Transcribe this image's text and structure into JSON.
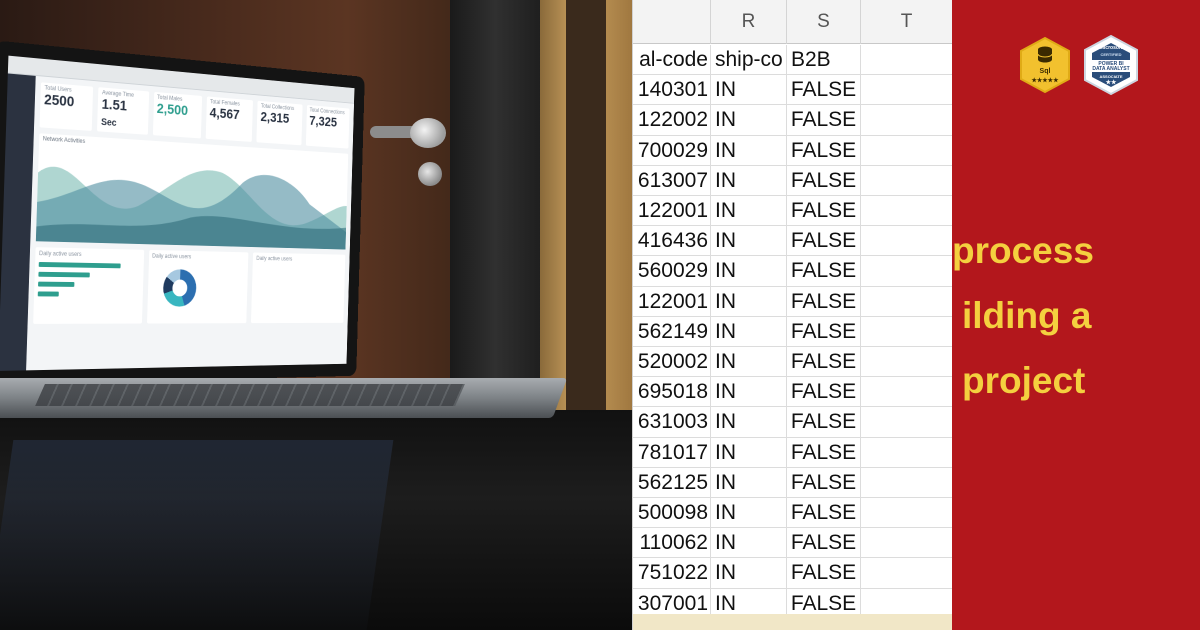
{
  "spreadsheet": {
    "column_headers": [
      "R",
      "S",
      "T"
    ],
    "field_headers": {
      "postal_code": "al-code",
      "ship_country": "ship-co",
      "b2b": "B2B"
    },
    "rows": [
      {
        "postal": "140301",
        "country": "IN",
        "b2b": "FALSE"
      },
      {
        "postal": "122002",
        "country": "IN",
        "b2b": "FALSE"
      },
      {
        "postal": "700029",
        "country": "IN",
        "b2b": "FALSE"
      },
      {
        "postal": "613007",
        "country": "IN",
        "b2b": "FALSE"
      },
      {
        "postal": "122001",
        "country": "IN",
        "b2b": "FALSE"
      },
      {
        "postal": "416436",
        "country": "IN",
        "b2b": "FALSE"
      },
      {
        "postal": "560029",
        "country": "IN",
        "b2b": "FALSE"
      },
      {
        "postal": "122001",
        "country": "IN",
        "b2b": "FALSE"
      },
      {
        "postal": "562149",
        "country": "IN",
        "b2b": "FALSE"
      },
      {
        "postal": "520002",
        "country": "IN",
        "b2b": "FALSE"
      },
      {
        "postal": "695018",
        "country": "IN",
        "b2b": "FALSE"
      },
      {
        "postal": "631003",
        "country": "IN",
        "b2b": "FALSE"
      },
      {
        "postal": "781017",
        "country": "IN",
        "b2b": "FALSE"
      },
      {
        "postal": "562125",
        "country": "IN",
        "b2b": "FALSE"
      },
      {
        "postal": "500098",
        "country": "IN",
        "b2b": "FALSE"
      },
      {
        "postal": "110062",
        "country": "IN",
        "b2b": "FALSE"
      },
      {
        "postal": "751022",
        "country": "IN",
        "b2b": "FALSE"
      },
      {
        "postal": "307001",
        "country": "IN",
        "b2b": "FALSE"
      }
    ]
  },
  "banner": {
    "line1": "process",
    "line2": "ilding a",
    "line3": "project",
    "text_color": "#f4d03f",
    "background_color": "#b3171c"
  },
  "badges": {
    "sql": {
      "label": "Sql",
      "stars": "★★★★★",
      "icon": "database-icon",
      "color": "#f2c12e"
    },
    "powerbi": {
      "top": "Microsoft",
      "sub": "CERTIFIED",
      "title1": "POWER BI",
      "title2": "DATA ANALYST",
      "level": "ASSOCIATE",
      "stars": "★★",
      "color": "#2a4d7a"
    }
  },
  "laptop_dashboard": {
    "stats": [
      {
        "label": "Total Users",
        "value": "2500"
      },
      {
        "label": "Average Time",
        "value": "1.51",
        "unit": "Sec"
      },
      {
        "label": "Total Males",
        "value": "2,500"
      },
      {
        "label": "Total Females",
        "value": "4,567"
      },
      {
        "label": "Total Collections",
        "value": "2,315"
      },
      {
        "label": "Total Connections",
        "value": "7,325"
      }
    ],
    "chart_title": "Network Activities",
    "panel1": "Daily active users",
    "panel2": "Daily active users",
    "panel3": "Daily active users",
    "values": [
      "123k",
      "53k",
      "3k"
    ]
  }
}
